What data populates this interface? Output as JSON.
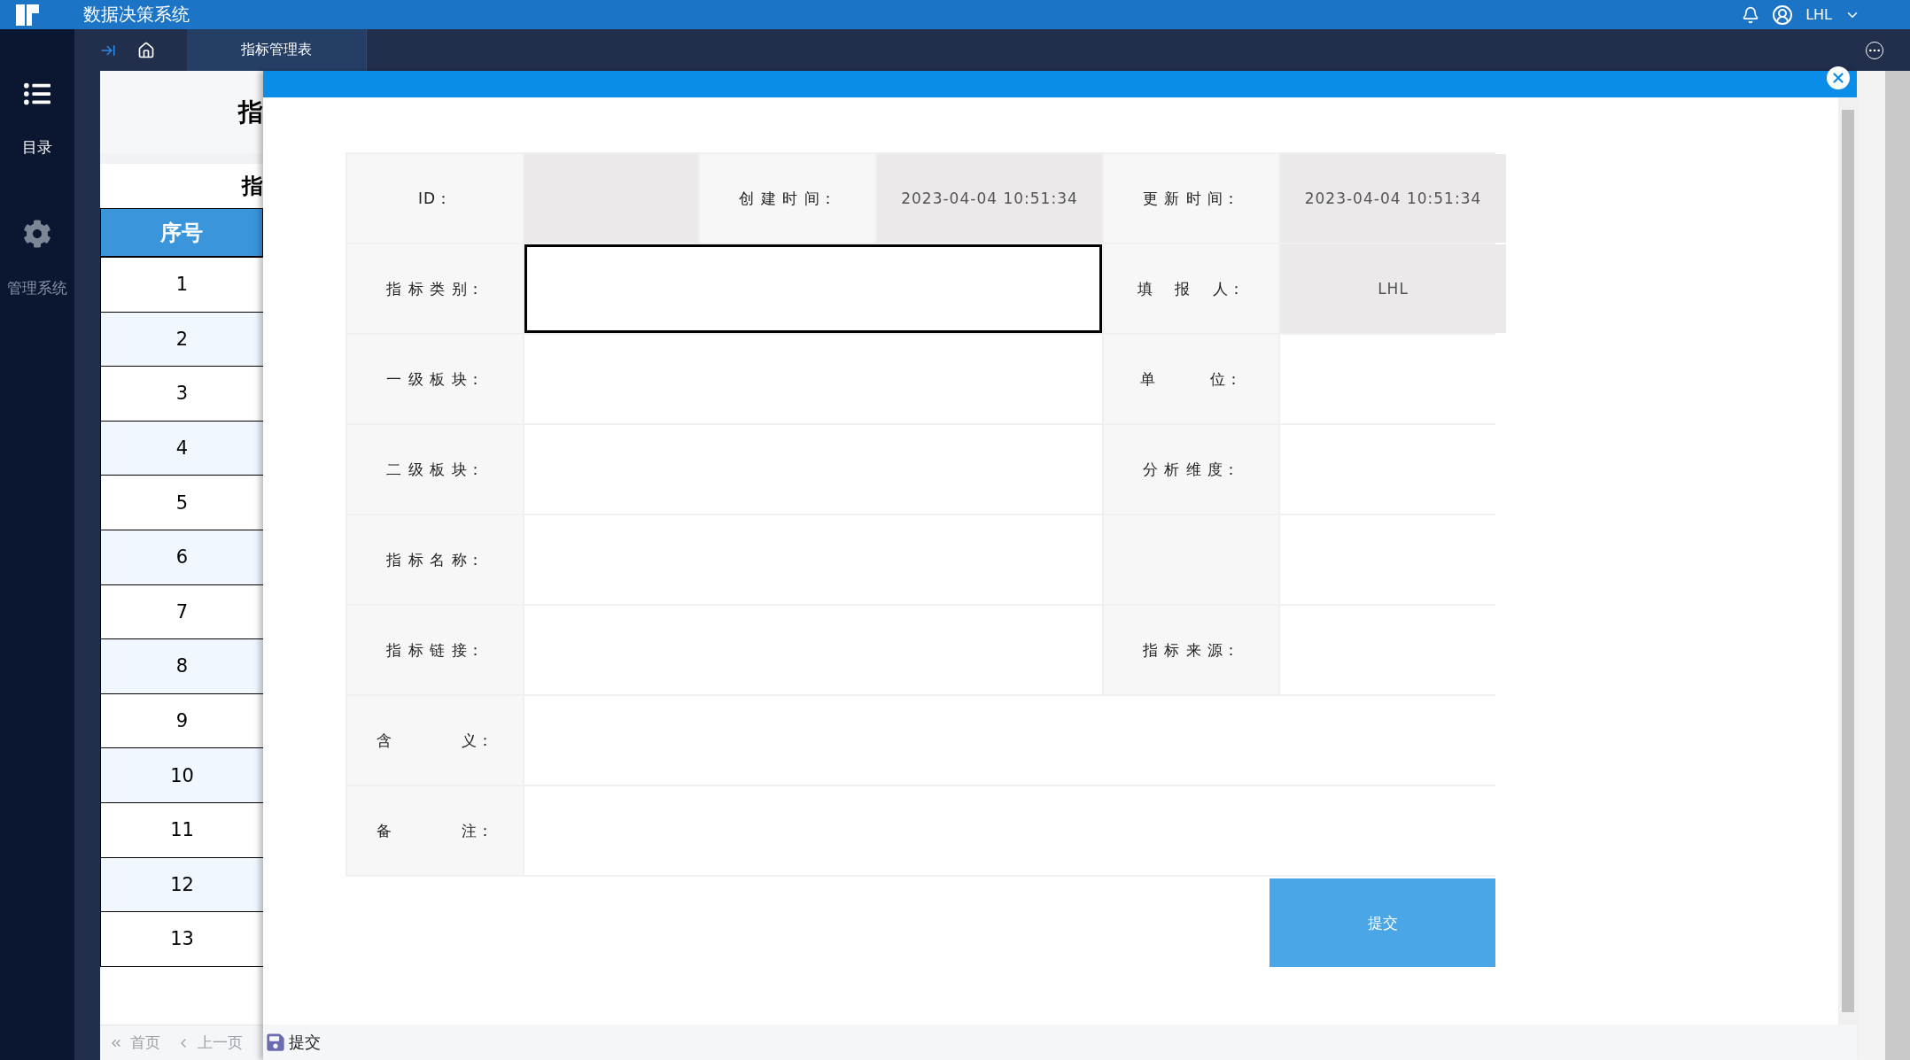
{
  "header": {
    "title": "数据决策系统",
    "user": "LHL"
  },
  "nav_tabs": [
    {
      "label": "指标管理表",
      "selected": true
    }
  ],
  "sidebar": {
    "items": [
      {
        "label": "目录",
        "kind": "list",
        "selected": true
      },
      {
        "label": "管理系统",
        "kind": "gear",
        "selected": false
      }
    ]
  },
  "background_page": {
    "title": "指",
    "subtitle": "指",
    "table": {
      "columns": [
        "序号"
      ],
      "rows": [
        "1",
        "2",
        "3",
        "4",
        "5",
        "6",
        "7",
        "8",
        "9",
        "10",
        "11",
        "12",
        "13"
      ]
    },
    "pagination": [
      "首页",
      "上一页"
    ]
  },
  "modal": {
    "form": [
      [
        {
          "kind": "label",
          "text": "ID："
        },
        {
          "kind": "readonly"
        },
        {
          "kind": "label",
          "text": "创 建 时 间："
        },
        {
          "kind": "readonly",
          "text": "2023-04-04 10:51:34"
        },
        {
          "kind": "label",
          "text": "更 新 时 间："
        },
        {
          "kind": "readonly",
          "text": "2023-04-04 10:51:34"
        }
      ],
      [
        {
          "kind": "label",
          "text": "指 标 类 别："
        },
        {
          "kind": "input",
          "focused": true
        },
        {
          "kind": "label",
          "text": "填　 报　 人："
        },
        {
          "kind": "readonly",
          "text": "LHL"
        }
      ],
      [
        {
          "kind": "label",
          "text": "一 级 板 块："
        },
        {
          "kind": "input",
          "focused": false
        },
        {
          "kind": "label",
          "text": "单　　　 位："
        },
        {
          "kind": "input",
          "focused": false
        }
      ],
      [
        {
          "kind": "label",
          "text": "二 级 板 块："
        },
        {
          "kind": "input",
          "focused": false
        },
        {
          "kind": "label",
          "text": "分 析 维 度："
        },
        {
          "kind": "input",
          "focused": false
        }
      ],
      [
        {
          "kind": "label",
          "text": "指 标 名 称："
        },
        {
          "kind": "input",
          "focused": false
        },
        {
          "kind": "label"
        },
        {
          "kind": "input",
          "focused": false
        }
      ],
      [
        {
          "kind": "label",
          "text": "指 标 链 接："
        },
        {
          "kind": "input",
          "focused": false
        },
        {
          "kind": "label",
          "text": "指 标 来 源："
        },
        {
          "kind": "input",
          "focused": false
        }
      ],
      [
        {
          "kind": "label",
          "text": "含　　　　 义："
        },
        {
          "kind": "input",
          "focused": false
        }
      ],
      [
        {
          "kind": "label",
          "text": "备　　　　 注："
        },
        {
          "kind": "input",
          "focused": false
        }
      ]
    ],
    "submit": "提交",
    "footer_button": "提交"
  }
}
